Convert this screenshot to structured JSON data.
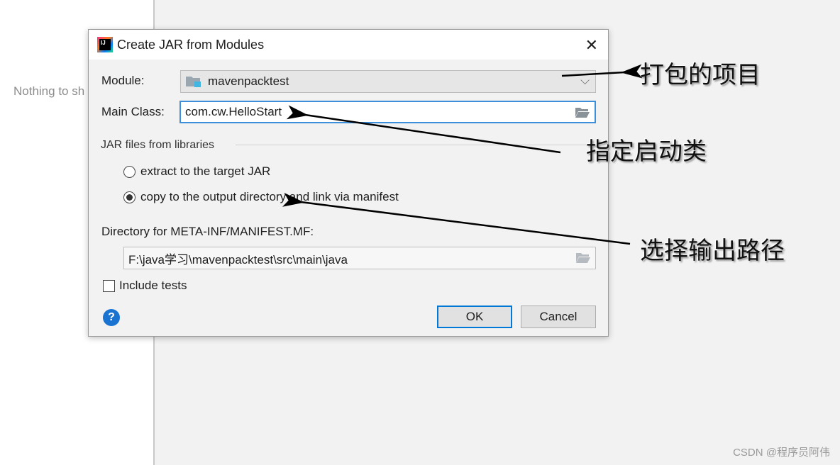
{
  "background": {
    "nothing_text": "Nothing to show"
  },
  "dialog": {
    "title": "Create JAR from Modules",
    "module_label": "Module:",
    "module_value": "mavenpacktest",
    "main_class_label": "Main Class:",
    "main_class_value": "com.cw.HelloStart",
    "jar_section": "JAR files from libraries",
    "radio_extract": "extract to the target JAR",
    "radio_copy": "copy to the output directory and link via manifest",
    "radio_selected": "copy",
    "manifest_label": "Directory for META-INF/MANIFEST.MF:",
    "manifest_value": "F:\\java学习\\mavenpacktest\\src\\main\\java",
    "include_tests": "Include tests",
    "include_tests_checked": false,
    "ok": "OK",
    "cancel": "Cancel",
    "help": "?"
  },
  "annotations": [
    "打包的项目",
    "指定启动类",
    "选择输出路径"
  ],
  "watermark": "CSDN @程序员阿伟",
  "colors": {
    "accent": "#0078d7",
    "focus": "#3d8fd9",
    "panel": "#f2f2f2"
  }
}
